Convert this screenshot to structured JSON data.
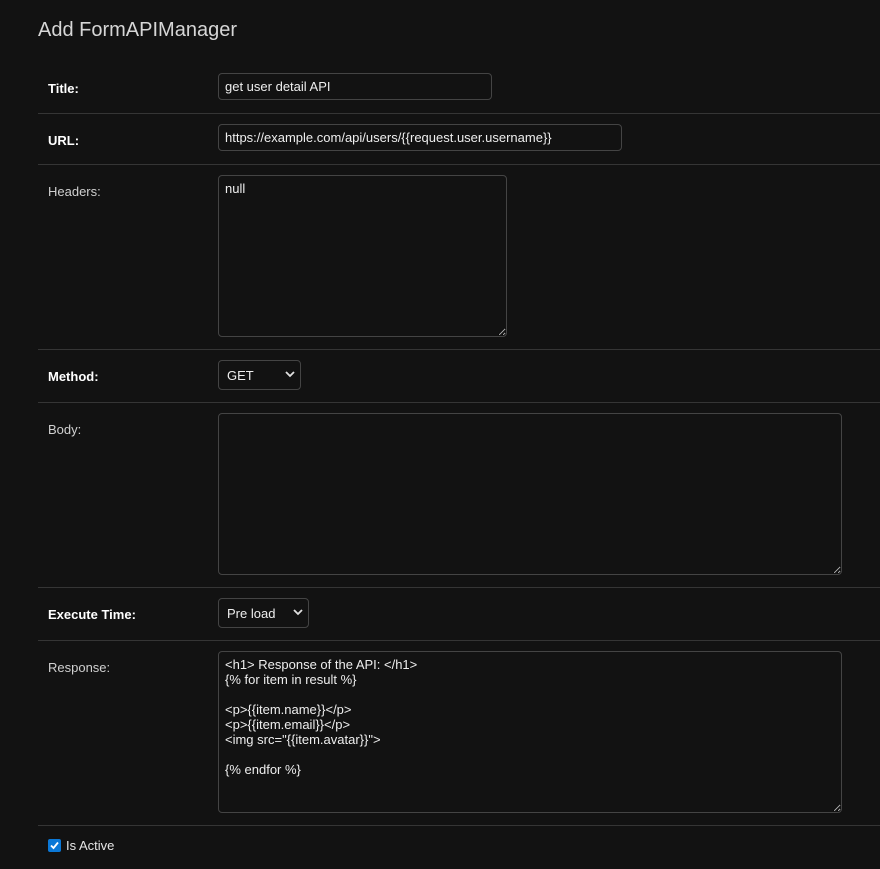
{
  "page": {
    "title": "Add FormAPIManager"
  },
  "form": {
    "title": {
      "label": "Title:",
      "value": "get user detail API"
    },
    "url": {
      "label": "URL:",
      "value": "https://example.com/api/users/{{request.user.username}}"
    },
    "headers": {
      "label": "Headers:",
      "value": "null"
    },
    "method": {
      "label": "Method:",
      "selected": "GET"
    },
    "body": {
      "label": "Body:",
      "value": ""
    },
    "execute_time": {
      "label": "Execute Time:",
      "selected": "Pre load"
    },
    "response": {
      "label": "Response:",
      "value": "<h1> Response of the API: </h1>\n{% for item in result %}\n\n<p>{{item.name}}</p>\n<p>{{item.email}}</p>\n<img src=\"{{item.avatar}}\">\n\n{% endfor %}"
    },
    "is_active": {
      "label": "Is Active",
      "checked": true
    }
  },
  "colors": {
    "background": "#121212",
    "border": "#444444",
    "checkbox_accent": "#0b78d6"
  }
}
